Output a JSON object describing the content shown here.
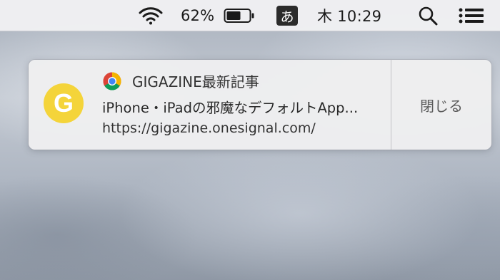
{
  "menubar": {
    "wifi_icon": "wifi-icon",
    "battery_percent": "62%",
    "battery_icon": "battery-icon",
    "ime_label": "あ",
    "clock": "木 10:29",
    "search_icon": "search-icon",
    "notification_center_icon": "list-icon"
  },
  "notification": {
    "app_logo_letter": "G",
    "browser_icon": "chrome-icon",
    "title": "GIGAZINE最新記事",
    "message": "iPhone・iPadの邪魔なデフォルトApp...",
    "url": "https://gigazine.onesignal.com/",
    "close_label": "閉じる",
    "logo_color": "#f4d43a"
  }
}
